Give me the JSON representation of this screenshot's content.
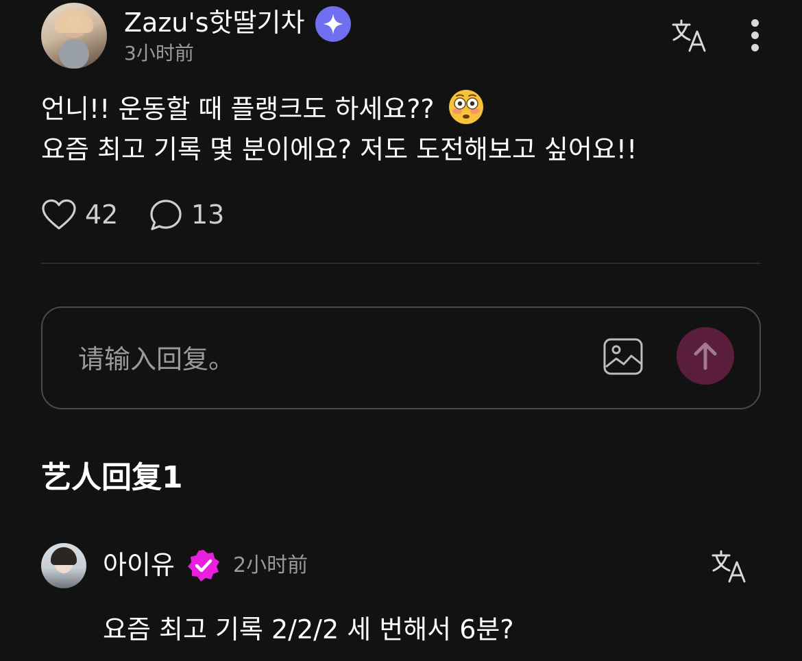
{
  "post": {
    "author_name": "Zazu's핫딸기차",
    "time": "3小时前",
    "body_lines": [
      "언니!! 운동할 때 플랭크도 하세요??",
      "요즘 최고 기록 몇 분이에요? 저도 도전해보고 싶어요!!"
    ],
    "emoji": "flushed-face-emoji",
    "likes": "42",
    "comments": "13"
  },
  "reply_input": {
    "placeholder": "请输入回复。"
  },
  "section": {
    "title": "艺人回复1"
  },
  "artist_reply": {
    "name": "아이유",
    "time": "2小时前",
    "text": "요즘 최고 기록 2/2/2 세 번해서 6분?"
  },
  "icons": {
    "translate": "translate-icon",
    "more": "more-vertical-icon",
    "like": "heart-icon",
    "comment": "comment-bubble-icon",
    "image": "image-icon",
    "send": "arrow-up-icon",
    "badge": "sparkle-badge-icon",
    "verified": "verified-badge-icon"
  },
  "colors": {
    "background": "#121212",
    "sparkle_badge": "#6f6ff0",
    "send_button": "#5a1d3c",
    "verified_badge": "#e81fdc"
  }
}
